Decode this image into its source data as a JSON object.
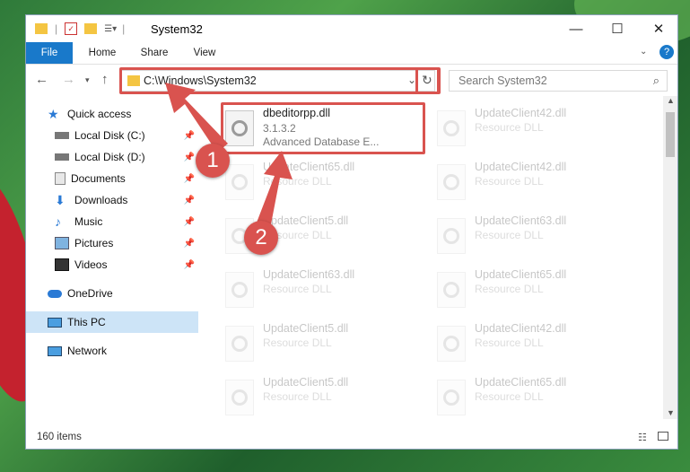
{
  "window": {
    "title": "System32",
    "controls": {
      "minimize": "—",
      "maximize": "☐",
      "close": "✕"
    }
  },
  "ribbon": {
    "tabs": [
      "File",
      "Home",
      "Share",
      "View"
    ],
    "help": "?"
  },
  "address": {
    "path": "C:\\Windows\\System32",
    "search_placeholder": "Search System32"
  },
  "nav": {
    "items": [
      {
        "label": "Quick access",
        "icon": "star-icon"
      },
      {
        "label": "Local Disk (C:)",
        "icon": "drive-icon",
        "pinned": true
      },
      {
        "label": "Local Disk (D:)",
        "icon": "drive-icon",
        "pinned": true
      },
      {
        "label": "Documents",
        "icon": "documents-icon",
        "pinned": true
      },
      {
        "label": "Downloads",
        "icon": "download-icon",
        "pinned": true
      },
      {
        "label": "Music",
        "icon": "music-icon",
        "pinned": true
      },
      {
        "label": "Pictures",
        "icon": "pictures-icon",
        "pinned": true
      },
      {
        "label": "Videos",
        "icon": "videos-icon",
        "pinned": true
      },
      {
        "label": "OneDrive",
        "icon": "cloud-icon"
      },
      {
        "label": "This PC",
        "icon": "pc-icon",
        "selected": true
      },
      {
        "label": "Network",
        "icon": "network-icon"
      }
    ]
  },
  "files": {
    "main": {
      "name": "dbeditorpp.dll",
      "version": "3.1.3.2",
      "description": "Advanced Database E..."
    },
    "background": [
      {
        "name": "UpdateClient42.dll",
        "desc": "Resource DLL"
      },
      {
        "name": "UpdateClient65.dll",
        "desc": "Resource DLL"
      },
      {
        "name": "UpdateClient42.dll",
        "desc": "Resource DLL"
      },
      {
        "name": "UpdateClient5.dll",
        "desc": "Resource DLL"
      },
      {
        "name": "UpdateClient63.dll",
        "desc": "Resource DLL"
      },
      {
        "name": "UpdateClient63.dll",
        "desc": "Resource DLL"
      },
      {
        "name": "UpdateClient65.dll",
        "desc": "Resource DLL"
      },
      {
        "name": "UpdateClient5.dll",
        "desc": "Resource DLL"
      },
      {
        "name": "UpdateClient42.dll",
        "desc": "Resource DLL"
      },
      {
        "name": "UpdateClient5.dll",
        "desc": "Resource DLL"
      },
      {
        "name": "UpdateClient65.dll",
        "desc": "Resource DLL"
      }
    ]
  },
  "status": {
    "count": "160 items"
  },
  "annotations": {
    "step1": "1",
    "step2": "2"
  },
  "colors": {
    "accent": "#1979ca",
    "highlight": "#d9534f",
    "selected": "#cde4f7"
  }
}
